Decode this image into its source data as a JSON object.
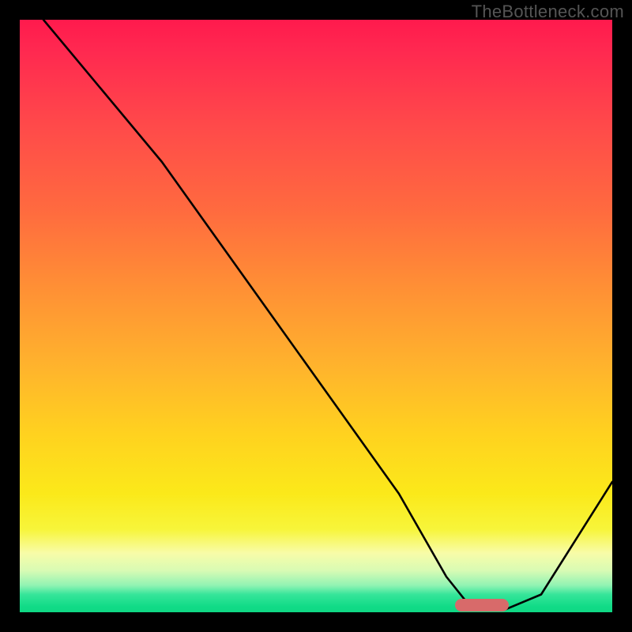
{
  "watermark": "TheBottleneck.com",
  "chart_data": {
    "type": "line",
    "title": "",
    "xlabel": "",
    "ylabel": "",
    "xlim": [
      0,
      100
    ],
    "ylim": [
      0,
      100
    ],
    "background": "vertical-gradient red→orange→yellow→green",
    "series": [
      {
        "name": "bottleneck-curve",
        "x": [
          4,
          14,
          24,
          34,
          44,
          54,
          64,
          72,
          76,
          82,
          88,
          100
        ],
        "y": [
          100,
          88,
          76,
          62,
          48,
          34,
          20,
          6,
          1,
          0.5,
          3,
          22
        ]
      }
    ],
    "annotations": [
      {
        "name": "optimum-bar",
        "x": 78,
        "y": 1.2,
        "color": "#d86a6a"
      }
    ]
  }
}
